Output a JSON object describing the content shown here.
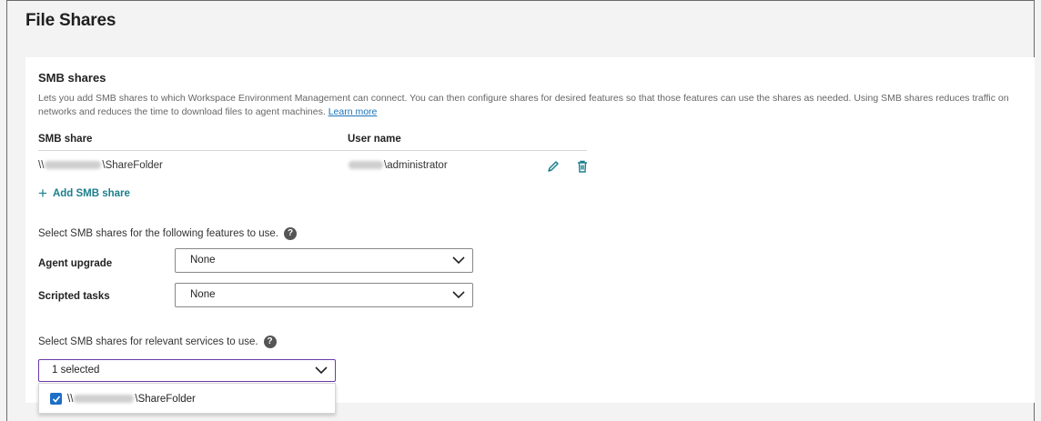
{
  "page": {
    "title": "File Shares"
  },
  "smb": {
    "section_title": "SMB shares",
    "description": "Lets you add SMB shares to which Workspace Environment Management can connect. You can then configure shares for desired features so that those features can use the shares as needed. Using SMB shares reduces traffic on networks and reduces the time to download files to agent machines.",
    "learn_more": "Learn more",
    "columns": {
      "share": "SMB share",
      "user": "User name"
    },
    "rows": [
      {
        "share_prefix": "\\\\",
        "share_suffix": "\\ShareFolder",
        "user_suffix": "\\administrator"
      }
    ],
    "add_label": "Add SMB share"
  },
  "features": {
    "prompt": "Select SMB shares for the following features to use.",
    "agent_upgrade": {
      "label": "Agent upgrade",
      "value": "None"
    },
    "scripted_tasks": {
      "label": "Scripted tasks",
      "value": "None"
    }
  },
  "services": {
    "prompt": "Select SMB shares for relevant services to use.",
    "selected": "1 selected",
    "options": [
      {
        "prefix": "\\\\",
        "suffix": "\\ShareFolder",
        "checked": true
      }
    ]
  },
  "colors": {
    "accent_teal": "#1b7f8c",
    "focus_purple": "#6b3aa8",
    "checkbox_blue": "#1e6fc7"
  },
  "icons": [
    "pencil-icon",
    "trash-icon",
    "plus-icon",
    "help-icon",
    "chevron-down-icon",
    "checkmark-icon"
  ]
}
